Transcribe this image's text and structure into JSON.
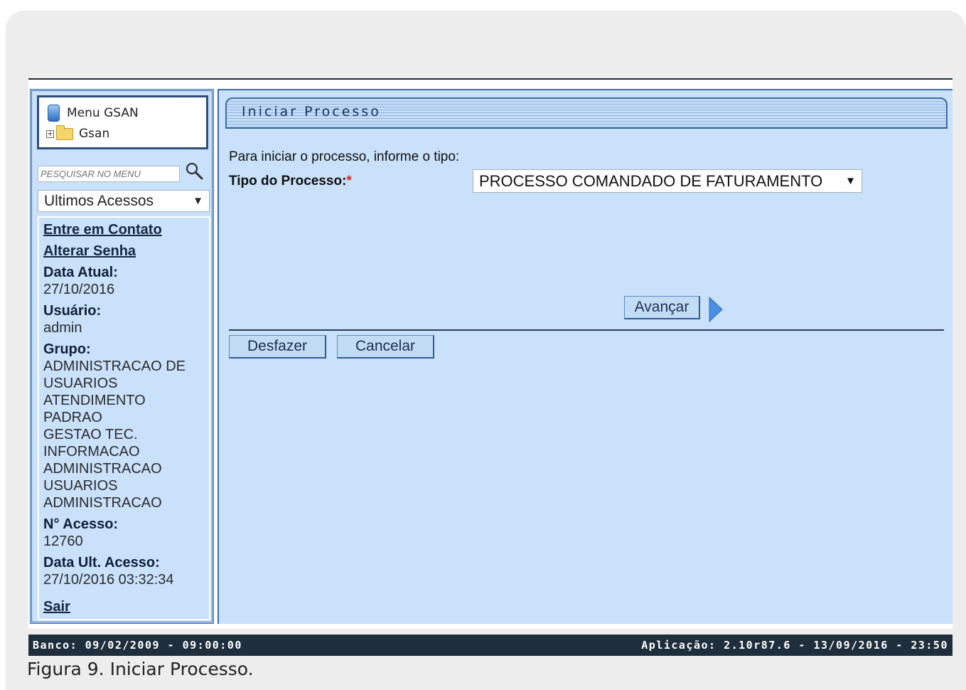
{
  "sidebar": {
    "menu_title": "Menu GSAN",
    "tree_root": "Gsan",
    "search_placeholder": "PESQUISAR NO MENU",
    "recent_select": "Ultimos Acessos",
    "links": {
      "contact": "Entre em Contato",
      "change_password": "Alterar Senha",
      "logout": "Sair"
    },
    "date_label": "Data Atual:",
    "date_value": "27/10/2016",
    "user_label": "Usuário:",
    "user_value": "admin",
    "group_label": "Grupo:",
    "groups": [
      "ADMINISTRACAO DE",
      "USUARIOS",
      "ATENDIMENTO",
      "PADRAO",
      "GESTAO TEC.",
      "INFORMACAO",
      "ADMINISTRACAO",
      "USUARIOS",
      "ADMINISTRACAO"
    ],
    "access_no_label": "N° Acesso:",
    "access_no_value": "12760",
    "last_access_label": "Data Ult. Acesso:",
    "last_access_value": "27/10/2016 03:32:34"
  },
  "main": {
    "title": "Iniciar Processo",
    "intro": "Para iniciar o processo, informe o tipo:",
    "tipo_label": "Tipo do Processo:",
    "required_mark": "*",
    "tipo_value": "PROCESSO COMANDADO DE FATURAMENTO",
    "buttons": {
      "avancar": "Avançar",
      "desfazer": "Desfazer",
      "cancelar": "Cancelar"
    }
  },
  "status": {
    "banco": "Banco: 09/02/2009 - 09:00:00",
    "aplicacao": "Aplicação: 2.10r87.6 - 13/09/2016 - 23:50"
  },
  "caption": "Figura 9. Iniciar Processo.",
  "icons": {
    "menu": "database-icon",
    "tree_expand": "plus-box-icon",
    "folder": "folder-icon",
    "search": "magnifier-icon",
    "next": "arrow-right-icon"
  },
  "colors": {
    "panel_bg": "#c9e1fb",
    "border": "#3d6ca5",
    "statusbar": "#1f2e3d",
    "required": "#e0201b",
    "button_bg": "#c2dcf6"
  }
}
